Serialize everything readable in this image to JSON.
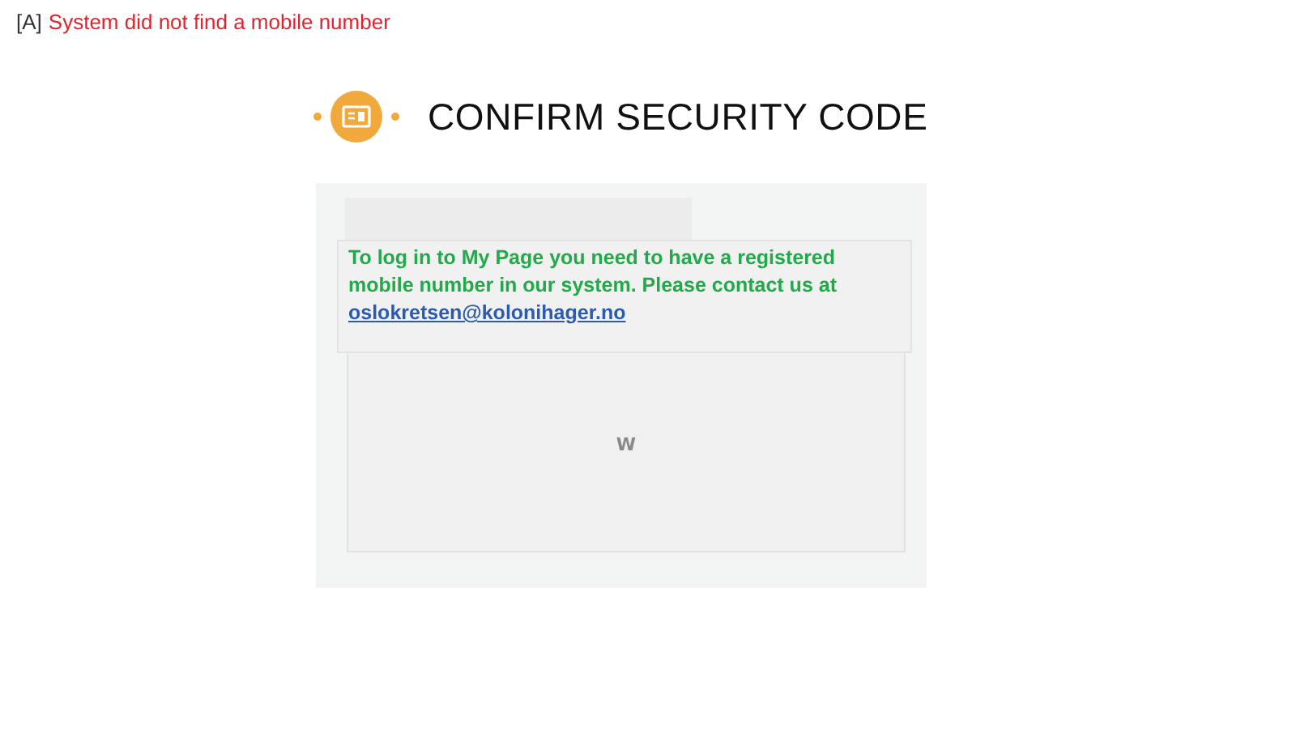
{
  "notice": {
    "tag": "[A]",
    "message": "System did not find a mobile number"
  },
  "title": "CONFIRM SECURITY CODE",
  "message": {
    "text": "To log in to My Page you need to have a registered mobile number in our system. Please contact us at",
    "email": "oslokretsen@kolonihager.no"
  },
  "overlay": {
    "text": "W"
  }
}
